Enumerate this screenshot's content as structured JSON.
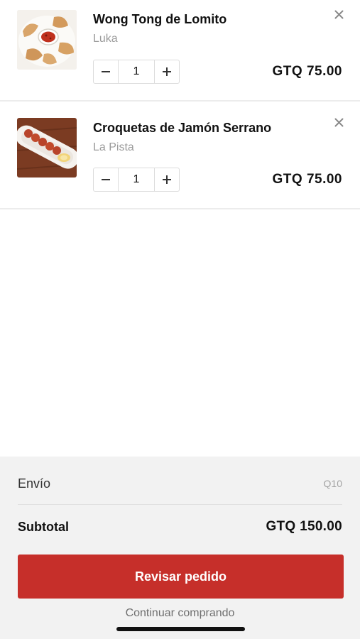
{
  "cart": {
    "items": [
      {
        "name": "Wong Tong de Lomito",
        "restaurant": "Luka",
        "quantity": "1",
        "price": "GTQ 75.00",
        "image_icon": "wonton-photo"
      },
      {
        "name": "Croquetas de Jamón Serrano",
        "restaurant": "La Pista",
        "quantity": "1",
        "price": "GTQ 75.00",
        "image_icon": "croquetas-photo"
      }
    ],
    "remove_icon": "close-icon",
    "decrement_icon": "minus-icon",
    "increment_icon": "plus-icon"
  },
  "summary": {
    "shipping_label": "Envío",
    "shipping_value": "Q10",
    "subtotal_label": "Subtotal",
    "subtotal_value": "GTQ 150.00",
    "review_button": "Revisar pedido",
    "continue_link": "Continuar comprando"
  },
  "colors": {
    "accent": "#c62f2a",
    "summary_bg": "#f2f2f2",
    "muted_text": "#9b9b9b"
  }
}
